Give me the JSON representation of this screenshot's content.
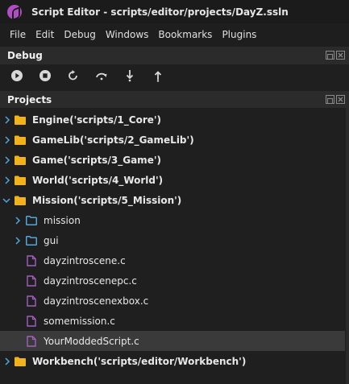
{
  "window": {
    "title": "Script Editor - scripts/editor/projects/DayZ.ssln"
  },
  "menu": [
    {
      "label": "File"
    },
    {
      "label": "Edit"
    },
    {
      "label": "Debug"
    },
    {
      "label": "Windows"
    },
    {
      "label": "Bookmarks"
    },
    {
      "label": "Plugins"
    }
  ],
  "debug_panel": {
    "title": "Debug",
    "buttons": [
      "play-icon",
      "stop-icon",
      "restart-icon",
      "step-over-icon",
      "step-into-icon",
      "step-out-icon"
    ]
  },
  "projects_panel": {
    "title": "Projects",
    "items": [
      {
        "label": "Engine('scripts/1_Core')",
        "type": "project",
        "expanded": false
      },
      {
        "label": "GameLib('scripts/2_GameLib')",
        "type": "project",
        "expanded": false
      },
      {
        "label": "Game('scripts/3_Game')",
        "type": "project",
        "expanded": false
      },
      {
        "label": "World('scripts/4_World')",
        "type": "project",
        "expanded": false
      },
      {
        "label": "Mission('scripts/5_Mission')",
        "type": "project",
        "expanded": true
      },
      {
        "label": "mission",
        "type": "folder",
        "expanded": false
      },
      {
        "label": "gui",
        "type": "folder",
        "expanded": false
      },
      {
        "label": "dayzintroscene.c",
        "type": "file"
      },
      {
        "label": "dayzintroscenepc.c",
        "type": "file"
      },
      {
        "label": "dayzintroscenexbox.c",
        "type": "file"
      },
      {
        "label": "somemission.c",
        "type": "file"
      },
      {
        "label": "YourModdedScript.c",
        "type": "file",
        "selected": true
      },
      {
        "label": "Workbench('scripts/editor/Workbench')",
        "type": "project",
        "expanded": false
      }
    ]
  },
  "colors": {
    "project_folder": "#f2b21c",
    "sub_folder": "#4ea8dd",
    "file_icon": "#a45ec1",
    "selection": "#3a3a3a"
  }
}
